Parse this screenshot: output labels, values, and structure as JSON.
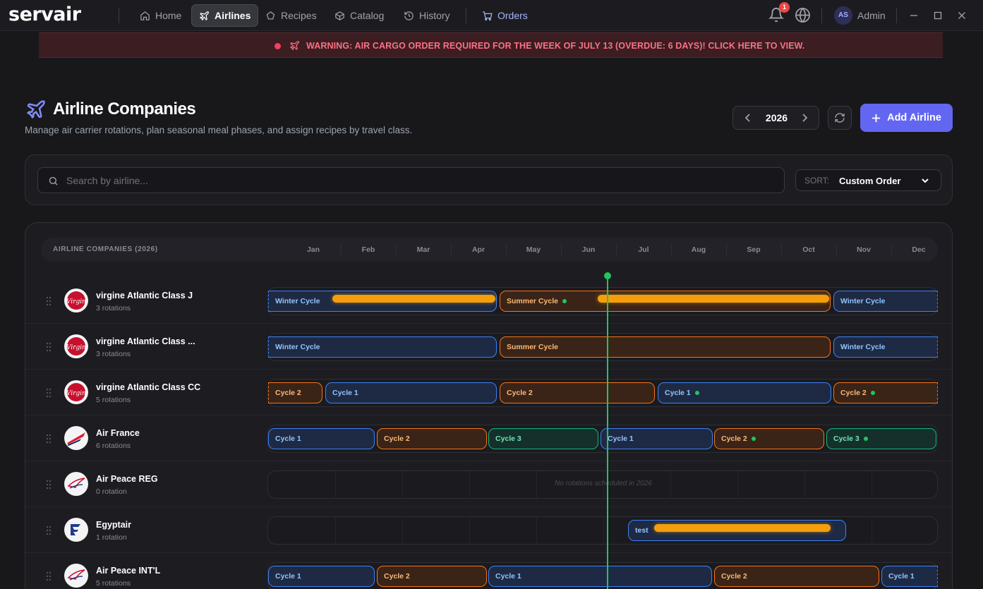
{
  "app": {
    "logo": "servair"
  },
  "nav": {
    "items": [
      {
        "label": "Home",
        "icon": "home-icon"
      },
      {
        "label": "Airlines",
        "icon": "plane-icon",
        "active": true
      },
      {
        "label": "Recipes",
        "icon": "chef-hat-icon"
      },
      {
        "label": "Catalog",
        "icon": "box-icon"
      },
      {
        "label": "History",
        "icon": "history-icon"
      },
      {
        "label": "Orders",
        "icon": "cart-icon"
      }
    ],
    "notifications_count": "1",
    "user_initials": "AS",
    "user_name": "Admin"
  },
  "warning": {
    "text": "WARNING: AIR CARGO ORDER REQUIRED FOR THE WEEK OF JULY 13 (OVERDUE: 6 DAYS)! CLICK HERE TO VIEW.",
    "color": "#fb7185"
  },
  "header": {
    "title": "Airline Companies",
    "subtitle": "Manage air carrier rotations, plan seasonal meal phases, and assign recipes by travel class.",
    "year": "2026",
    "add_button": "Add Airline"
  },
  "filters": {
    "search_placeholder": "Search by airline...",
    "sort_label": "SORT:",
    "sort_value": "Custom Order"
  },
  "table": {
    "header_label": "AIRLINE COMPANIES (2026)",
    "months": [
      "Jan",
      "Feb",
      "Mar",
      "Apr",
      "May",
      "Jun",
      "Jul",
      "Aug",
      "Sep",
      "Oct",
      "Nov",
      "Dec"
    ],
    "empty_text": "No rotations scheduled in 2026",
    "rows": [
      {
        "name": "virgine Atlantic Class J",
        "count": "3 rotations",
        "logo": "virgin"
      },
      {
        "name": "virgine Atlantic Class ...",
        "count": "3 rotations",
        "logo": "virgin"
      },
      {
        "name": "virgine Atlantic Class CC",
        "count": "5 rotations",
        "logo": "virgin"
      },
      {
        "name": "Air France",
        "count": "6 rotations",
        "logo": "airfrance"
      },
      {
        "name": "Air Peace REG",
        "count": "0 rotation",
        "logo": "airpeace"
      },
      {
        "name": "Egyptair",
        "count": "1 rotation",
        "logo": "egyptair"
      },
      {
        "name": "Air Peace INT'L",
        "count": "5 rotations",
        "logo": "airpeace"
      }
    ],
    "segment_labels": {
      "winter": "Winter Cycle",
      "summer": "Summer Cycle",
      "c1": "Cycle 1",
      "c2": "Cycle 2",
      "c3": "Cycle 3",
      "test": "test"
    }
  },
  "colors": {
    "accent": "#6366f1",
    "blue": "#3b82f6",
    "orange": "#f97316",
    "green": "#10b981",
    "progress": "#f59e0b",
    "today": "#22c55e"
  }
}
